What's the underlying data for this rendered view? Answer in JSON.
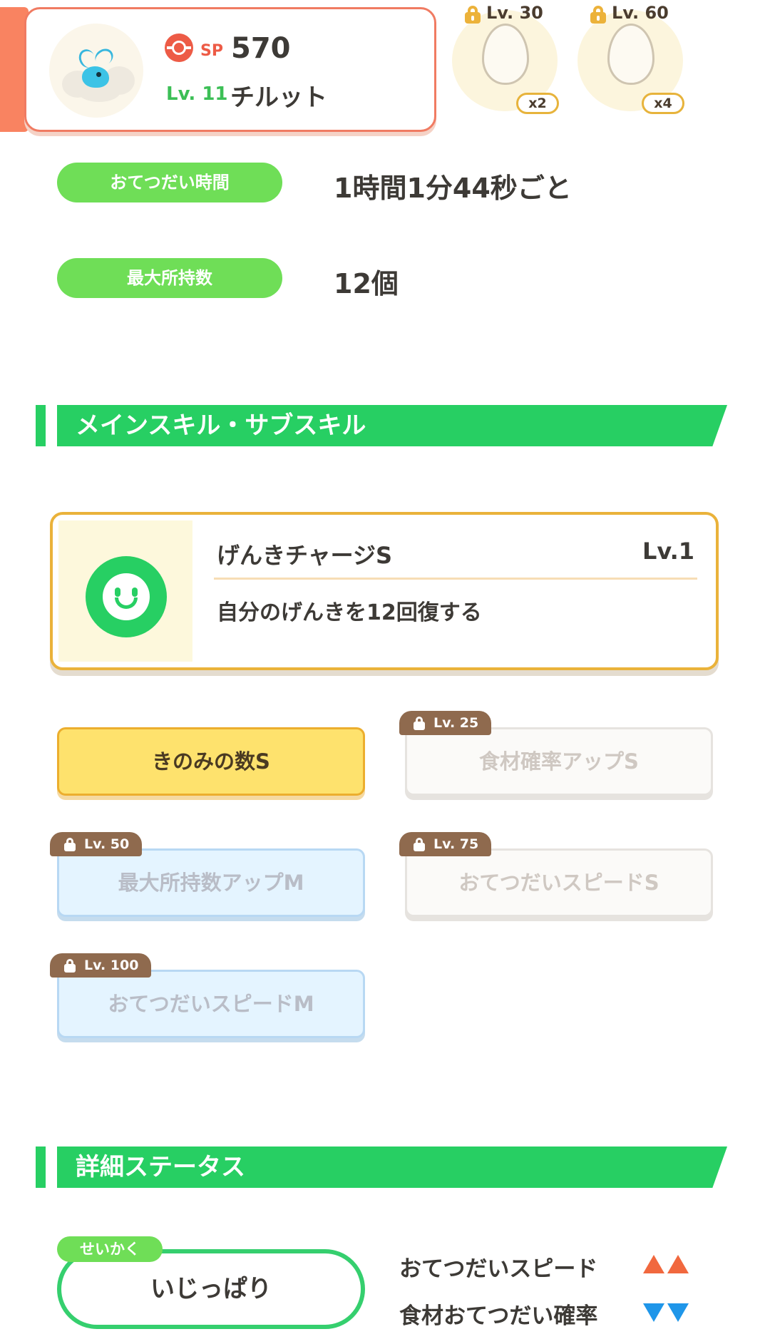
{
  "pokemon": {
    "sp_label": "SP",
    "sp_value": "570",
    "level_label": "Lv. 11",
    "name": "チルット"
  },
  "eggs": [
    {
      "level": "Lv. 30",
      "count": "x2"
    },
    {
      "level": "Lv. 60",
      "count": "x4"
    }
  ],
  "info": {
    "help_time_label": "おてつだい時間",
    "help_time_value": "1時間1分44秒ごと",
    "max_hold_label": "最大所持数",
    "max_hold_value": "12個"
  },
  "skills_section": {
    "title": "メインスキル・サブスキル",
    "main_skill": {
      "name": "げんきチャージS",
      "level": "Lv.1",
      "description": "自分のげんきを12回復する"
    },
    "sub_skills": [
      {
        "name": "きのみの数S",
        "unlock_level": ""
      },
      {
        "name": "食材確率アップS",
        "unlock_level": "Lv. 25"
      },
      {
        "name": "最大所持数アップM",
        "unlock_level": "Lv. 50"
      },
      {
        "name": "おてつだいスピードS",
        "unlock_level": "Lv. 75"
      },
      {
        "name": "おてつだいスピードM",
        "unlock_level": "Lv. 100"
      }
    ]
  },
  "status_section": {
    "title": "詳細ステータス",
    "nature_tag": "せいかく",
    "nature": "いじっぱり",
    "effects": [
      {
        "label": "おてつだいスピード",
        "direction": "up"
      },
      {
        "label": "食材おてつだい確率",
        "direction": "down"
      }
    ]
  },
  "colors": {
    "accent_coral": "#f07b62",
    "section_green": "#27cf63",
    "pill_green": "#6fde57",
    "gold": "#eab23a",
    "up_arrow": "#f1683e",
    "down_arrow": "#1f96e9"
  }
}
